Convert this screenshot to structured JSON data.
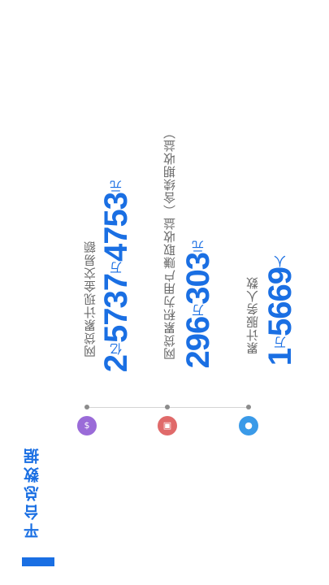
{
  "section": {
    "title": "平台总数据"
  },
  "stats": [
    {
      "label": "网贷累计现金交易额",
      "parts": [
        "2",
        "亿",
        "5737",
        "万",
        "4753",
        "元"
      ],
      "icon": "money-bag-icon",
      "color": "#9a6bd8"
    },
    {
      "label": "网贷累积为用户赚取收益（含续期收益）",
      "parts": [
        "296",
        "万",
        "303",
        "元"
      ],
      "icon": "gift-icon",
      "color": "#e06a6a"
    },
    {
      "label": "累计服务人数",
      "parts": [
        "1",
        "万",
        "5669",
        "人"
      ],
      "icon": "people-icon",
      "color": "#3a9ae8"
    }
  ]
}
